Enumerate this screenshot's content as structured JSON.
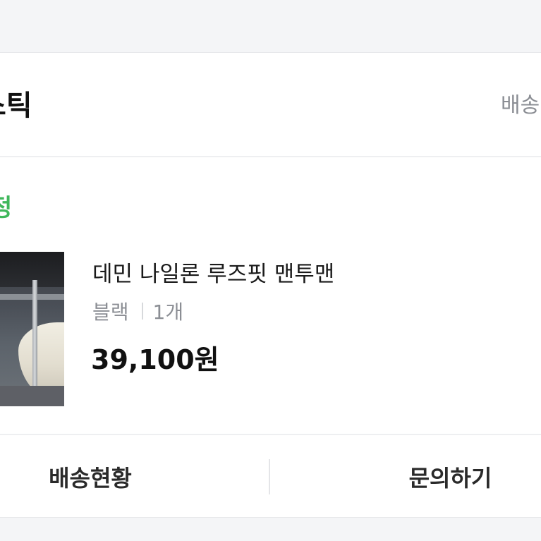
{
  "order": {
    "brand_title": "스틱",
    "delivery_link": "배송",
    "status": "정",
    "product": {
      "name": "데민 나일론 루즈핏 맨투맨",
      "color": "블랙",
      "quantity": "1개",
      "price": "39,100원"
    },
    "actions": {
      "tracking_label": "배송현황",
      "inquiry_label": "문의하기"
    }
  },
  "colors": {
    "status_green": "#3fb75b",
    "background": "#f4f5f7",
    "card": "#ffffff"
  }
}
